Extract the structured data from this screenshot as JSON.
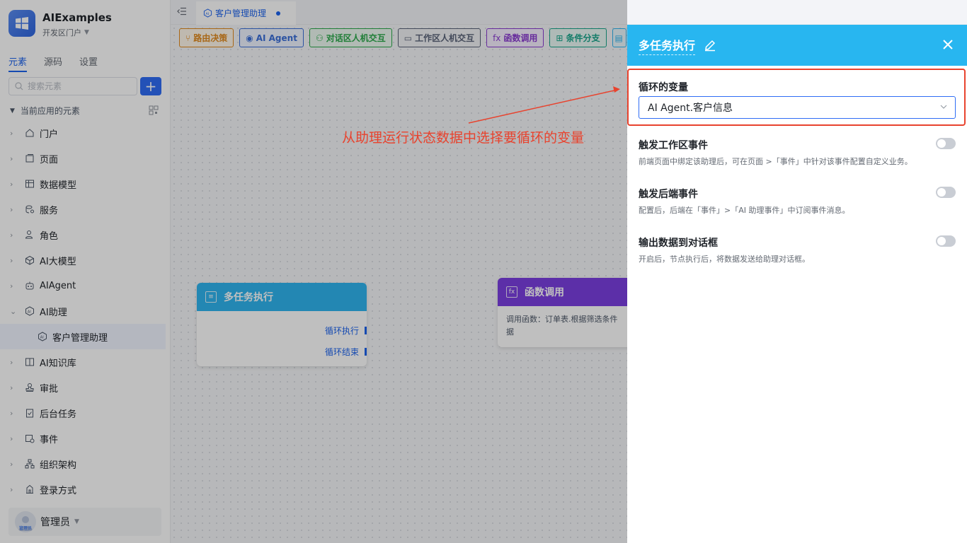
{
  "app": {
    "name": "AIExamples",
    "portal": "开发区门户"
  },
  "side_tabs": [
    "元素",
    "源码",
    "设置"
  ],
  "search": {
    "placeholder": "搜索元素",
    "add_label": "+"
  },
  "tree_header": "当前应用的元素",
  "tree_items": [
    {
      "label": "门户",
      "icon": "home-icon"
    },
    {
      "label": "页面",
      "icon": "page-icon"
    },
    {
      "label": "数据模型",
      "icon": "table-icon"
    },
    {
      "label": "服务",
      "icon": "service-icon"
    },
    {
      "label": "角色",
      "icon": "role-icon"
    },
    {
      "label": "AI大模型",
      "icon": "cube-icon"
    },
    {
      "label": "AIAgent",
      "icon": "robot-icon"
    },
    {
      "label": "AI助理",
      "icon": "ai-icon"
    },
    {
      "label": "客户管理助理",
      "icon": "ai-icon"
    },
    {
      "label": "AI知识库",
      "icon": "book-icon"
    },
    {
      "label": "审批",
      "icon": "stamp-icon"
    },
    {
      "label": "后台任务",
      "icon": "task-icon"
    },
    {
      "label": "事件",
      "icon": "event-icon"
    },
    {
      "label": "组织架构",
      "icon": "org-icon"
    },
    {
      "label": "登录方式",
      "icon": "login-icon"
    }
  ],
  "user": {
    "name": "管理员",
    "avatar_caption": "管理员"
  },
  "doc_tab": {
    "label": "客户管理助理"
  },
  "toolbar": [
    {
      "label": "路由决策",
      "color": "#e08a1e",
      "icon": "⑂"
    },
    {
      "label": "AI Agent",
      "color": "#3b6fd9",
      "icon": "◉"
    },
    {
      "label": "对话区人机交互",
      "color": "#2aa84a",
      "icon": "⚇"
    },
    {
      "label": "工作区人机交互",
      "color": "#5a6378",
      "icon": "▭"
    },
    {
      "label": "函数调用",
      "color": "#8a3bd1",
      "icon": "fx"
    },
    {
      "label": "条件分支",
      "color": "#17a58a",
      "icon": "⊞"
    }
  ],
  "nodes": {
    "loop": {
      "title": "多任务执行",
      "ports": [
        "循环执行",
        "循环结束"
      ],
      "color": "#2fb4ef"
    },
    "func": {
      "title": "函数调用",
      "body": "调用函数：订单表.根据筛选条件",
      "body2": "据",
      "color": "#7b3fe0"
    }
  },
  "annotation": "从助理运行状态数据中选择要循环的变量",
  "panel": {
    "title": "多任务执行",
    "var_label": "循环的变量",
    "var_value": "AI Agent.客户信息",
    "options": [
      {
        "title": "触发工作区事件",
        "desc": "前端页面中绑定该助理后，可在页面 >「事件」中针对该事件配置自定义业务。",
        "on": false
      },
      {
        "title": "触发后端事件",
        "desc": "配置后，后端在「事件」>「AI 助理事件」中订阅事件消息。",
        "on": false
      },
      {
        "title": "输出数据到对话框",
        "desc": "开启后，节点执行后，将数据发送给助理对话框。",
        "on": false
      }
    ]
  }
}
